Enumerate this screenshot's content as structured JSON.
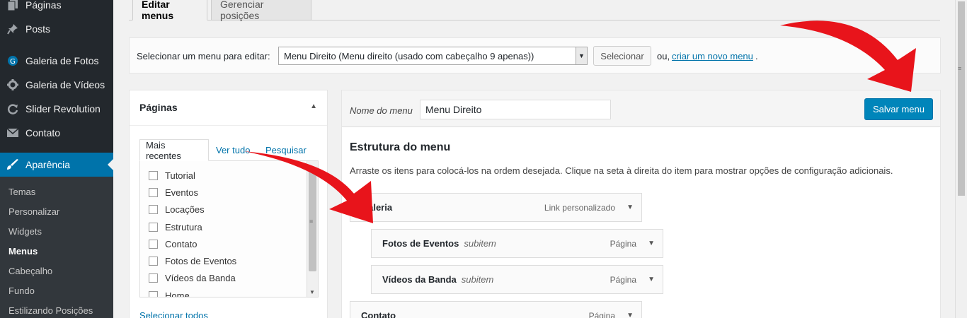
{
  "sidebar": {
    "items": [
      {
        "label": "Páginas",
        "icon": "pages-icon"
      },
      {
        "label": "Posts",
        "icon": "pin-icon"
      },
      {
        "label": "Galeria de Fotos",
        "icon": "gallery-icon"
      },
      {
        "label": "Galeria de Vídeos",
        "icon": "gear-icon"
      },
      {
        "label": "Slider Revolution",
        "icon": "refresh-icon"
      },
      {
        "label": "Contato",
        "icon": "envelope-icon"
      },
      {
        "label": "Aparência",
        "icon": "brush-icon"
      }
    ],
    "submenu": [
      "Temas",
      "Personalizar",
      "Widgets",
      "Menus",
      "Cabeçalho",
      "Fundo",
      "Estilizando Posições"
    ]
  },
  "tabs": {
    "edit": "Editar menus",
    "manage": "Gerenciar posições"
  },
  "select_bar": {
    "label": "Selecionar um menu para editar:",
    "selected": "Menu Direito (Menu direito (usado com cabeçalho 9 apenas))",
    "button": "Selecionar",
    "or": "ou,",
    "new_link": "criar um novo menu",
    "period": "."
  },
  "left_panel": {
    "title": "Páginas",
    "tabs": [
      "Mais recentes",
      "Ver tudo",
      "Pesquisar"
    ],
    "items": [
      "Tutorial",
      "Eventos",
      "Locações",
      "Estrutura",
      "Contato",
      "Fotos de Eventos",
      "Vídeos da Banda",
      "Home"
    ],
    "select_all": "Selecionar todos"
  },
  "right_panel": {
    "name_label": "Nome do menu",
    "name_value": "Menu Direito",
    "save_button": "Salvar menu",
    "structure_title": "Estrutura do menu",
    "structure_desc": "Arraste os itens para colocá-los na ordem desejada. Clique na seta à direita do item para mostrar opções de configuração adicionais.",
    "menu_items": [
      {
        "title": "Galeria",
        "sub": "",
        "type": "Link personalizado"
      },
      {
        "title": "Fotos de Eventos",
        "sub": "subitem",
        "type": "Página"
      },
      {
        "title": "Vídeos da Banda",
        "sub": "subitem",
        "type": "Página"
      },
      {
        "title": "Contato",
        "sub": "",
        "type": "Página"
      }
    ]
  },
  "colors": {
    "sidebar_bg": "#23282d",
    "active": "#0073aa",
    "save_button": "#0085ba",
    "arrow": "#e8141b"
  }
}
